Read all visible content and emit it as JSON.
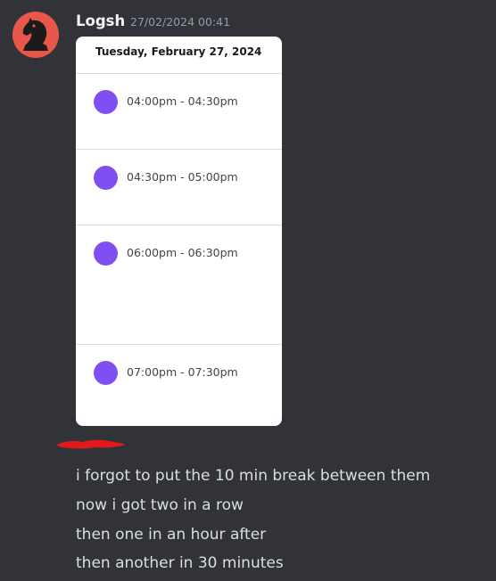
{
  "message": {
    "username": "Logsh",
    "timestamp": "27/02/2024 00:41",
    "attachment": {
      "date": "Tuesday, February 27, 2024",
      "slots": [
        {
          "time": "04:00pm - 04:30pm"
        },
        {
          "time": "04:30pm - 05:00pm"
        },
        {
          "time": "06:00pm - 06:30pm"
        },
        {
          "time": "07:00pm - 07:30pm"
        }
      ]
    }
  },
  "follow_up_lines": [
    "i forgot to put the 10 min break between them",
    "now i got two in a row",
    "then one in an hour after",
    "then another in 30 minutes"
  ],
  "colors": {
    "background": "#313338",
    "avatar": "#e8574a",
    "slot_dot": "#7f4ff2",
    "redaction": "#e0191c"
  }
}
